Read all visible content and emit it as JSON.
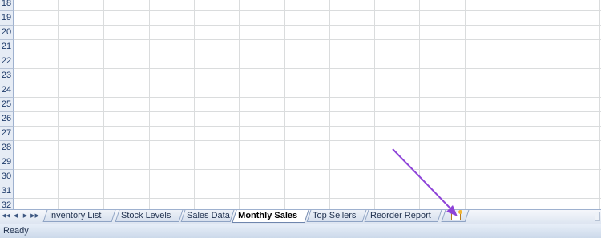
{
  "rows": [
    "18",
    "19",
    "20",
    "21",
    "22",
    "23",
    "24",
    "25",
    "26",
    "27",
    "28",
    "29",
    "30",
    "31",
    "32"
  ],
  "sheet_tabs": [
    {
      "label": "Inventory List"
    },
    {
      "label": "Stock Levels"
    },
    {
      "label": "Sales Data"
    },
    {
      "label": "Monthly Sales",
      "active": true
    },
    {
      "label": "Top Sellers"
    },
    {
      "label": "Reorder Report"
    }
  ],
  "nav_buttons": [
    "first-sheet",
    "prev-sheet",
    "next-sheet",
    "last-sheet"
  ],
  "status": {
    "text": "Ready"
  },
  "colors": {
    "arrow": "#8e44d8",
    "header_bg": "#e6ecf5",
    "grid_line": "#dadcdd",
    "tab_border": "#8ea3c4"
  }
}
